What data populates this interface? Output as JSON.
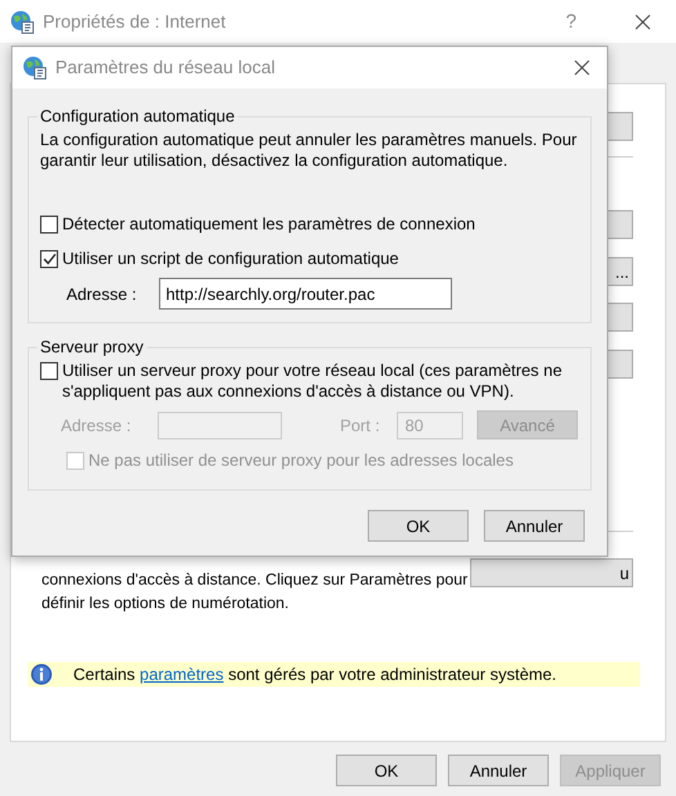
{
  "window": {
    "title": "Propriétés de : Internet",
    "help": "?"
  },
  "side_buttons": [
    {
      "kind": "blank"
    },
    {
      "kind": "blank"
    },
    {
      "kind": "labeled",
      "label": "..."
    },
    {
      "kind": "blank"
    },
    {
      "kind": "blank"
    },
    {
      "kind": "labeled",
      "label": "u"
    }
  ],
  "dialup_text": "connexions d'accès à distance. Cliquez sur Paramètres pour définir les options de numérotation.",
  "info_bar": {
    "text_before": "Certains",
    "link": "paramètres",
    "text_after": "sont gérés par votre administrateur système."
  },
  "footer_buttons": [
    {
      "label": "OK",
      "disabled": false
    },
    {
      "label": "Annuler",
      "disabled": false
    },
    {
      "label": "Appliquer",
      "disabled": true
    }
  ],
  "dialog": {
    "title": "Paramètres du réseau local",
    "auto_config": {
      "legend": "Configuration automatique",
      "description": "La configuration automatique peut annuler les paramètres manuels. Pour garantir leur utilisation, désactivez la configuration automatique.",
      "options": [
        {
          "label": "Détecter automatiquement les paramètres de connexion",
          "checked": false
        },
        {
          "label": "Utiliser un script de configuration automatique",
          "checked": true
        }
      ],
      "address": {
        "label": "Adresse :",
        "value": "http://searchly.org/router.pac"
      }
    },
    "proxy": {
      "legend": "Serveur proxy",
      "use_proxy": {
        "label": "Utiliser un serveur proxy pour votre réseau local (ces paramètres ne s'appliquent pas aux connexions d'accès à distance ou VPN).",
        "checked": false
      },
      "address": {
        "label": "Adresse :",
        "disabled": true
      },
      "port": {
        "label": "Port :",
        "value": "80",
        "disabled": true
      },
      "advanced": {
        "label": "Avancé",
        "disabled": true
      },
      "bypass_local": {
        "label": "Ne pas utiliser de serveur proxy pour les adresses locales",
        "checked": false,
        "disabled": true
      }
    },
    "buttons": [
      {
        "label": "OK"
      },
      {
        "label": "Annuler"
      }
    ]
  }
}
